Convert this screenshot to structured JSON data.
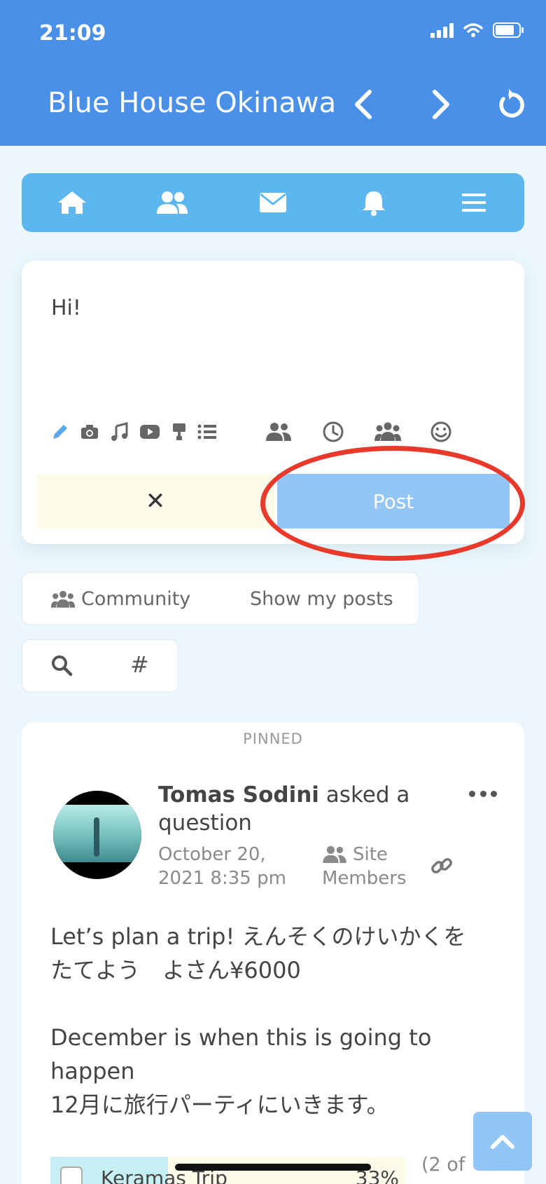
{
  "status_bar": {
    "time": "21:09"
  },
  "header": {
    "title": "Blue House Okinawa"
  },
  "composer": {
    "text": "Hi!",
    "cancel_label": "✕",
    "post_label": "Post"
  },
  "filters": {
    "community_label": "Community",
    "show_my_posts_label": "Show my posts",
    "hashtag_label": "#"
  },
  "post": {
    "pinned_label": "PINNED",
    "author_name": "Tomas Sodini",
    "action": "asked a question",
    "date_line1": "October 20,",
    "date_line2": "2021 8:35 pm",
    "audience_line1": "Site",
    "audience_line2": "Members",
    "body_line1": "Let’s plan a trip! えんそくのけいかくを",
    "body_line2": "たてよう　よさん¥6000",
    "body_line3": "December is when this is going to",
    "body_line4": "happen",
    "body_line5": "12月に旅行パーティにいきます。",
    "poll_option_label": "Keramas Trip",
    "poll_option_pct": "33%",
    "poll_option_value": 0.33,
    "poll_count": "(2 of"
  },
  "colors": {
    "header": "#4a90e8",
    "nav": "#5db7ee",
    "post_button": "#93c6f5",
    "highlight_ring": "#e8392b",
    "page_bg": "#ebf7fc"
  }
}
